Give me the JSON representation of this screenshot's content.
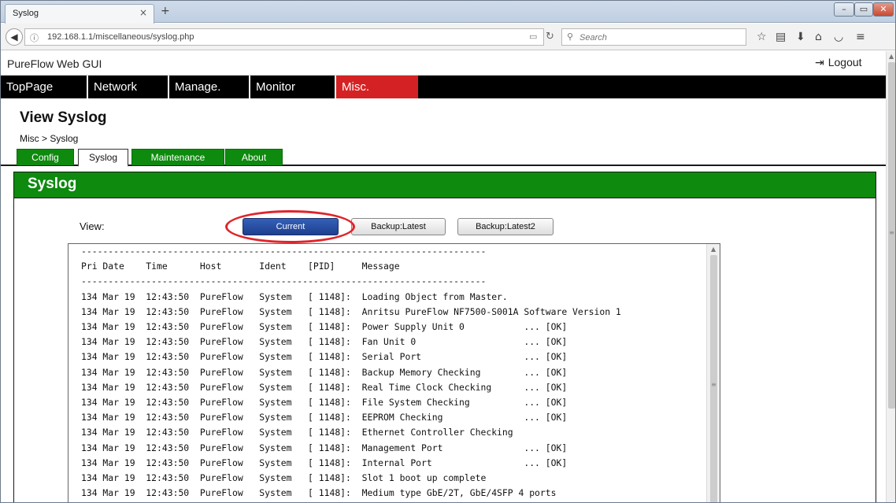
{
  "browser": {
    "tab_title": "Syslog",
    "tab_close": "×",
    "new_tab": "+",
    "url": "192.168.1.1/miscellaneous/syslog.php",
    "search_placeholder": "Search"
  },
  "header": {
    "app_title": "PureFlow Web GUI",
    "logout_label": "Logout"
  },
  "main_menu": [
    {
      "label": "TopPage"
    },
    {
      "label": "Network"
    },
    {
      "label": "Manage."
    },
    {
      "label": "Monitor"
    },
    {
      "label": "Misc.",
      "active": true
    }
  ],
  "page": {
    "title": "View Syslog",
    "breadcrumb": "Misc > Syslog"
  },
  "sub_tabs": [
    {
      "label": "Config"
    },
    {
      "label": "Syslog",
      "active": true
    },
    {
      "label": "Maintenance"
    },
    {
      "label": "About"
    }
  ],
  "panel": {
    "title": "Syslog",
    "view_label": "View:",
    "buttons": [
      {
        "label": "Current",
        "selected": true
      },
      {
        "label": "Backup:Latest"
      },
      {
        "label": "Backup:Latest2"
      }
    ]
  },
  "log": {
    "separator": "---------------------------------------------------------------------------",
    "header_line": "Pri Date    Time      Host       Ident    [PID]     Message",
    "lines": [
      "134 Mar 19  12:43:50  PureFlow   System   [ 1148]:  Loading Object from Master.",
      "134 Mar 19  12:43:50  PureFlow   System   [ 1148]:  Anritsu PureFlow NF7500-S001A Software Version 1",
      "134 Mar 19  12:43:50  PureFlow   System   [ 1148]:  Power Supply Unit 0           ... [OK]",
      "134 Mar 19  12:43:50  PureFlow   System   [ 1148]:  Fan Unit 0                    ... [OK]",
      "134 Mar 19  12:43:50  PureFlow   System   [ 1148]:  Serial Port                   ... [OK]",
      "134 Mar 19  12:43:50  PureFlow   System   [ 1148]:  Backup Memory Checking        ... [OK]",
      "134 Mar 19  12:43:50  PureFlow   System   [ 1148]:  Real Time Clock Checking      ... [OK]",
      "134 Mar 19  12:43:50  PureFlow   System   [ 1148]:  File System Checking          ... [OK]",
      "134 Mar 19  12:43:50  PureFlow   System   [ 1148]:  EEPROM Checking               ... [OK]",
      "134 Mar 19  12:43:50  PureFlow   System   [ 1148]:  Ethernet Controller Checking",
      "134 Mar 19  12:43:50  PureFlow   System   [ 1148]:  Management Port               ... [OK]",
      "134 Mar 19  12:43:50  PureFlow   System   [ 1148]:  Internal Port                 ... [OK]",
      "134 Mar 19  12:43:50  PureFlow   System   [ 1148]:  Slot 1 boot up complete",
      "134 Mar 19  12:43:50  PureFlow   System   [ 1148]:  Medium type GbE/2T, GbE/4SFP 4 ports"
    ]
  },
  "colors": {
    "menu_active": "#d42224",
    "panel_green": "#0e8a0e",
    "button_selected": "#2a4fa8",
    "highlight": "#e0242a"
  }
}
